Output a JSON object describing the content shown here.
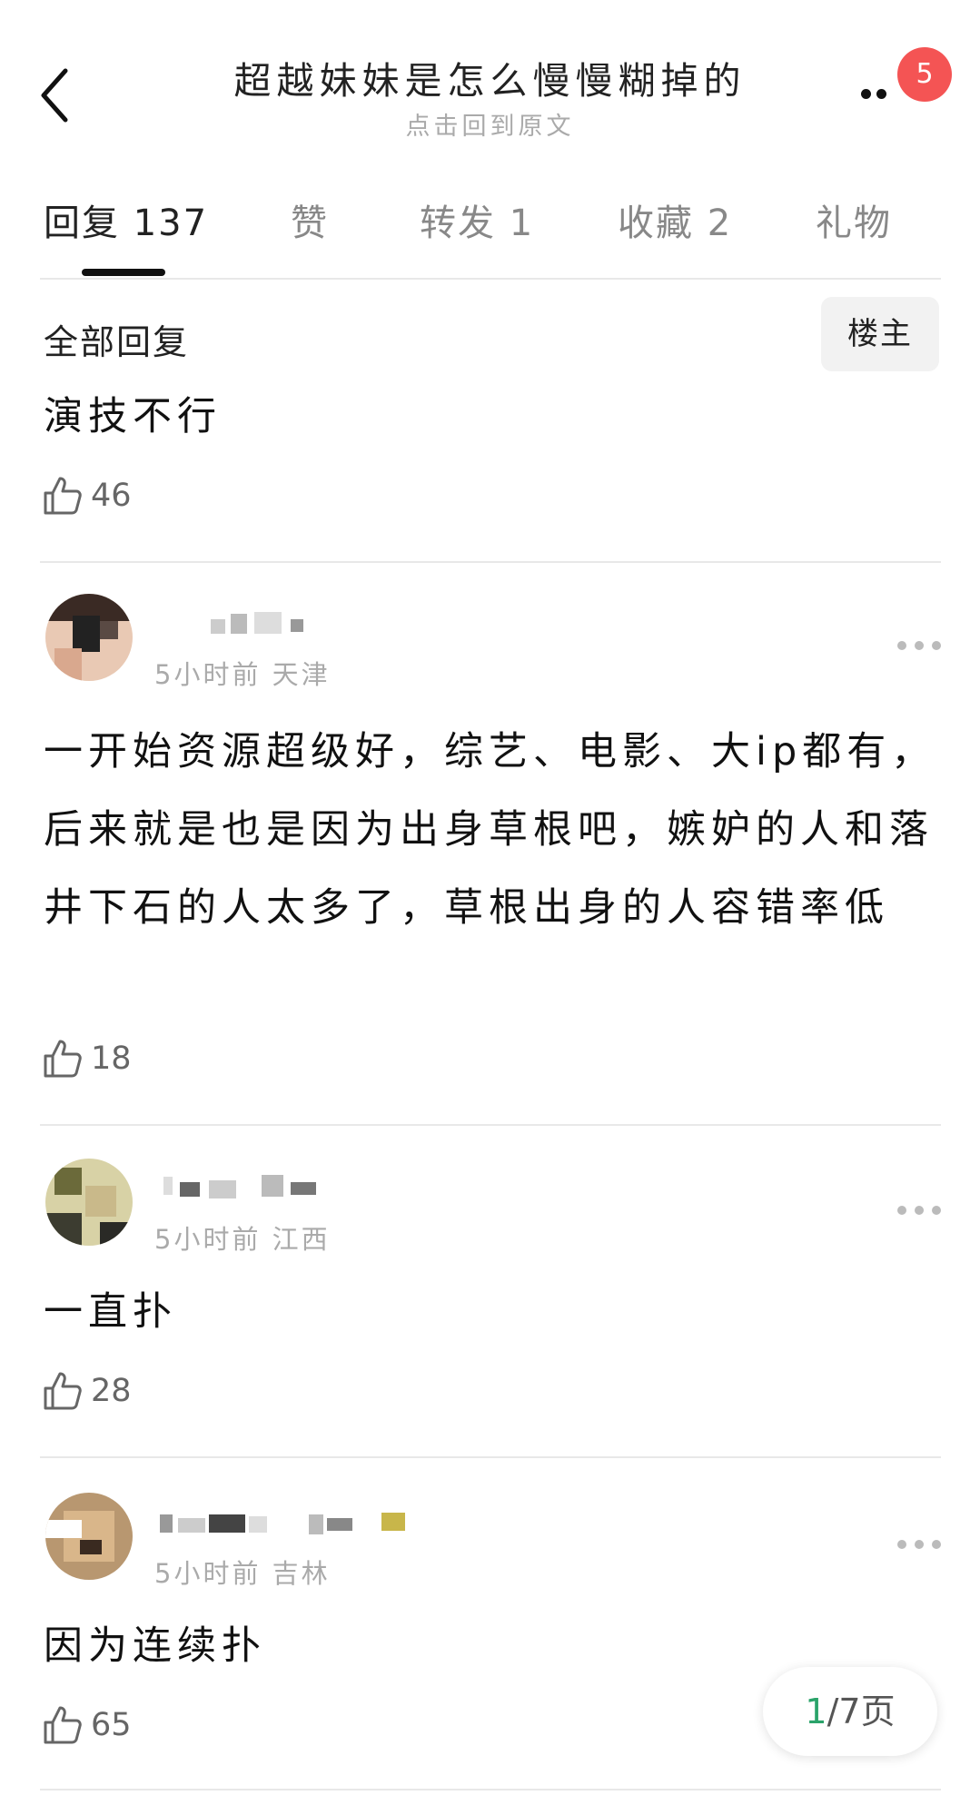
{
  "header": {
    "title": "超越妹妹是怎么慢慢糊掉的",
    "subtitle": "点击回到原文",
    "notification_count": "5"
  },
  "tabs": [
    {
      "label": "回复 137",
      "active": true
    },
    {
      "label": "赞",
      "active": false
    },
    {
      "label": "转发 1",
      "active": false
    },
    {
      "label": "收藏 2",
      "active": false
    },
    {
      "label": "礼物",
      "active": false
    }
  ],
  "filter": {
    "section_label": "全部回复",
    "owner_button": "楼主"
  },
  "top_reply": {
    "content": "演技不行",
    "likes": "46"
  },
  "comments": [
    {
      "time_location": "5小时前 天津",
      "content": "一开始资源超级好，综艺、电影、大ip都有，后来就是也是因为出身草根吧，嫉妒的人和落井下石的人太多了，草根出身的人容错率低",
      "likes": "18"
    },
    {
      "time_location": "5小时前 江西",
      "content": "一直扑",
      "likes": "28"
    },
    {
      "time_location": "5小时前 吉林",
      "content": "因为连续扑",
      "likes": "65"
    }
  ],
  "pager": {
    "current": "1",
    "total": "/7页"
  },
  "colors": {
    "badge": "#f45454",
    "pager_current": "#2aa36a",
    "divider": "#e8e8e8"
  },
  "icons": [
    "back-arrow-icon",
    "more-dots-icon",
    "thumbs-up-icon"
  ]
}
